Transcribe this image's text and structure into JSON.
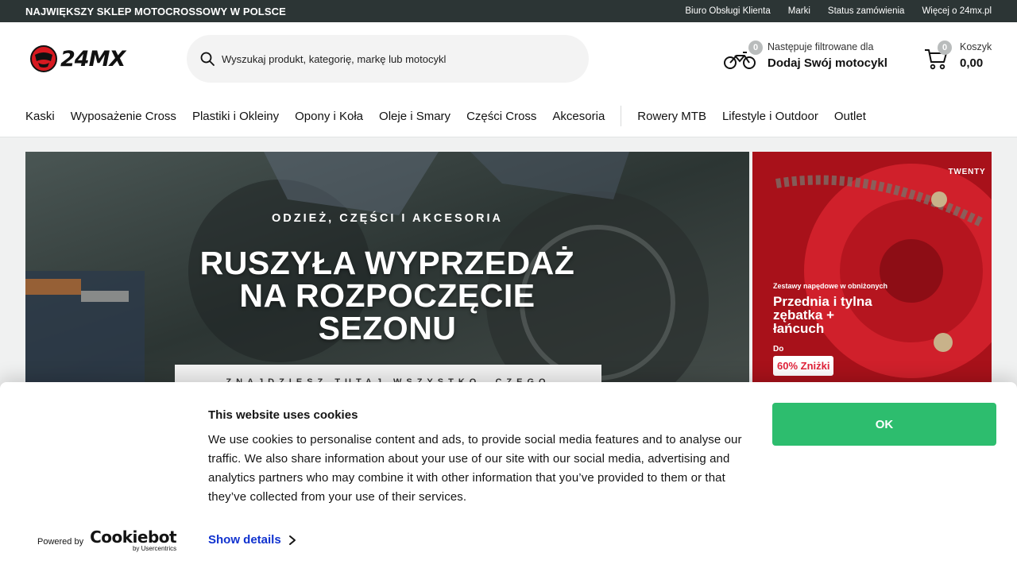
{
  "topbar": {
    "tagline": "NAJWIĘKSZY SKLEP MOTOCROSSOWY W POLSCE",
    "links": [
      "Biuro Obsługi Klienta",
      "Marki",
      "Status zamówienia",
      "Więcej o 24mx.pl"
    ]
  },
  "header": {
    "logo_text": "24MX",
    "search_placeholder": "Wyszukaj produkt, kategorię, markę lub motocykl",
    "bike": {
      "count": "0",
      "label": "Następuje filtrowane dla",
      "action": "Dodaj Swój motocykl"
    },
    "cart": {
      "count": "0",
      "label": "Koszyk",
      "total": "0,00"
    }
  },
  "nav": {
    "primary": [
      "Kaski",
      "Wyposażenie Cross",
      "Plastiki i Okleiny",
      "Opony i Koła",
      "Oleje i Smary",
      "Części Cross",
      "Akcesoria"
    ],
    "secondary": [
      "Rowery MTB",
      "Lifestyle i Outdoor",
      "Outlet"
    ]
  },
  "banner_main": {
    "kicker": "ODZIEŻ, CZĘŚCI I AKCESORIA",
    "headline": [
      "RUSZYŁA WYPRZEDAŻ",
      "NA ROZPOCZĘCIE",
      "SEZONU"
    ],
    "strip": "ZNAJDZIESZ TUTAJ WSZYSTKO, CZEGO POTRZEBUJESZ"
  },
  "banner_side": {
    "brand": "TWENTY",
    "small": "Zestawy napędowe w obniżonych",
    "headline": "Przednia i tylna zębatka + łańcuch",
    "prefix": "Do",
    "discount": "60% Zniżki"
  },
  "cookie": {
    "title": "This website uses cookies",
    "text": "We use cookies to personalise content and ads, to provide social media features and to analyse our traffic. We also share information about your use of our site with our social media, advertising and analytics partners who may combine it with other information that you’ve provided to them or that they’ve collected from your use of their services.",
    "ok_label": "OK",
    "show_details": "Show details",
    "powered_by": "Powered by",
    "brand": "Cookiebot",
    "brand_sub": "by Usercentrics"
  },
  "colors": {
    "topbar": "#2c3535",
    "accept": "#2dbd6e",
    "link": "#1032cf",
    "logo_red": "#d71920"
  }
}
